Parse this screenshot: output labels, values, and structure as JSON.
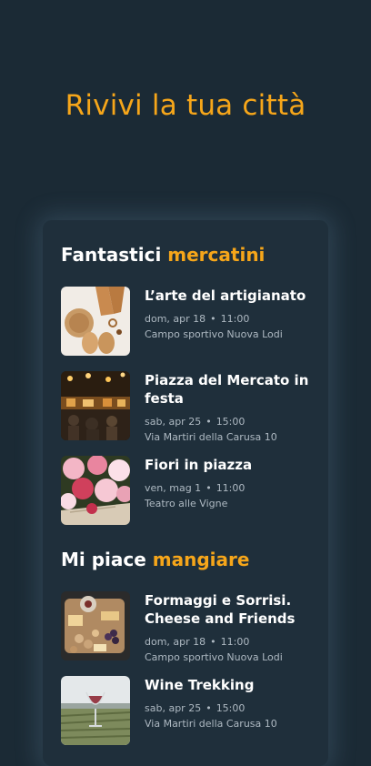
{
  "hero": {
    "title": "Rivivi la tua città"
  },
  "sections": [
    {
      "title_prefix": "Fantastici",
      "title_accent": "mercatini",
      "events": [
        {
          "title": "L’arte del artigianato",
          "date": "dom, apr 18",
          "time": "11:00",
          "place": "Campo sportivo Nuova Lodi"
        },
        {
          "title": "Piazza del Mercato in festa",
          "date": "sab, apr 25",
          "time": "15:00",
          "place": "Via Martiri della Carusa 10"
        },
        {
          "title": "Fiori in piazza",
          "date": "ven, mag 1",
          "time": "11:00",
          "place": "Teatro alle Vigne"
        }
      ]
    },
    {
      "title_prefix": "Mi piace",
      "title_accent": "mangiare",
      "events": [
        {
          "title": "Formaggi e Sorrisi. Cheese and Friends",
          "date": "dom, apr 18",
          "time": "11:00",
          "place": "Campo sportivo Nuova Lodi"
        },
        {
          "title": "Wine Trekking",
          "date": "sab, apr 25",
          "time": "15:00",
          "place": "Via Martiri della Carusa 10"
        }
      ]
    }
  ],
  "colors": {
    "background": "#1b2a35",
    "card": "#1f2f3b",
    "accent": "#f6a61a",
    "meta": "#aeb9c2"
  },
  "icons": {
    "separator": "•"
  }
}
